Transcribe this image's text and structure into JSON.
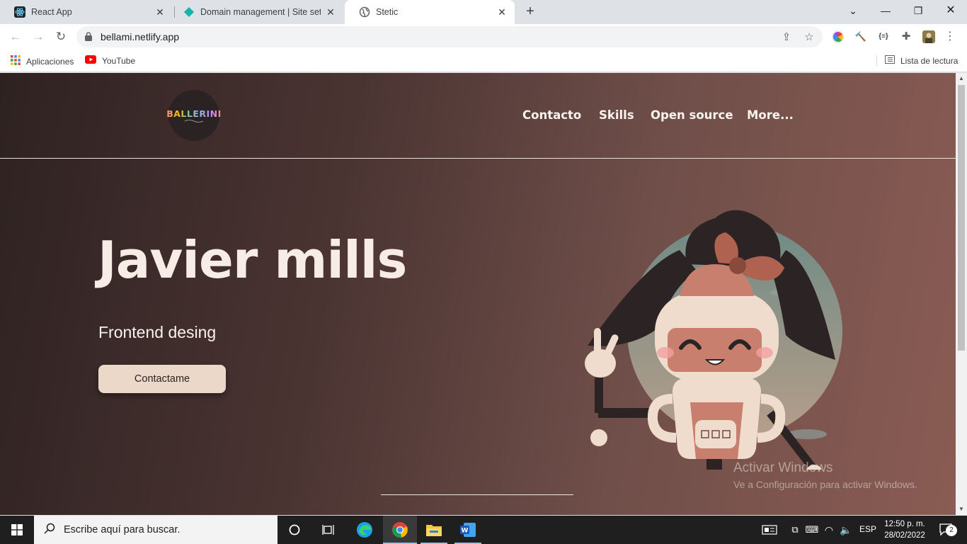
{
  "browser": {
    "tabs": [
      {
        "title": "React App",
        "icon": "react-icon",
        "active": false
      },
      {
        "title": "Domain management | Site settin",
        "icon": "netlify-icon",
        "active": false
      },
      {
        "title": "Stetic",
        "icon": "globe-icon",
        "active": true
      }
    ],
    "url": "bellami.netlify.app",
    "bookmarks": [
      {
        "label": "Aplicaciones",
        "icon": "apps-grid-icon"
      },
      {
        "label": "YouTube",
        "icon": "youtube-icon"
      }
    ],
    "reading_list_label": "Lista de lectura"
  },
  "site": {
    "logo_text": "BALLERINI",
    "nav": [
      "Contacto",
      "Skills",
      "Open source",
      "More..."
    ],
    "hero": {
      "title": "Javier mills",
      "subtitle": "Frontend desing",
      "cta_label": "Contactame"
    },
    "colors": {
      "accent": "#ecd8c8",
      "gradient_start": "#2e2221",
      "gradient_end": "#8a5c53"
    }
  },
  "watermark": {
    "line1": "Activar Windows",
    "line2": "Ve a Configuración para activar Windows."
  },
  "taskbar": {
    "search_placeholder": "Escribe aquí para buscar.",
    "language": "ESP",
    "time": "12:50 p. m.",
    "date": "28/02/2022",
    "notification_count": "2"
  }
}
